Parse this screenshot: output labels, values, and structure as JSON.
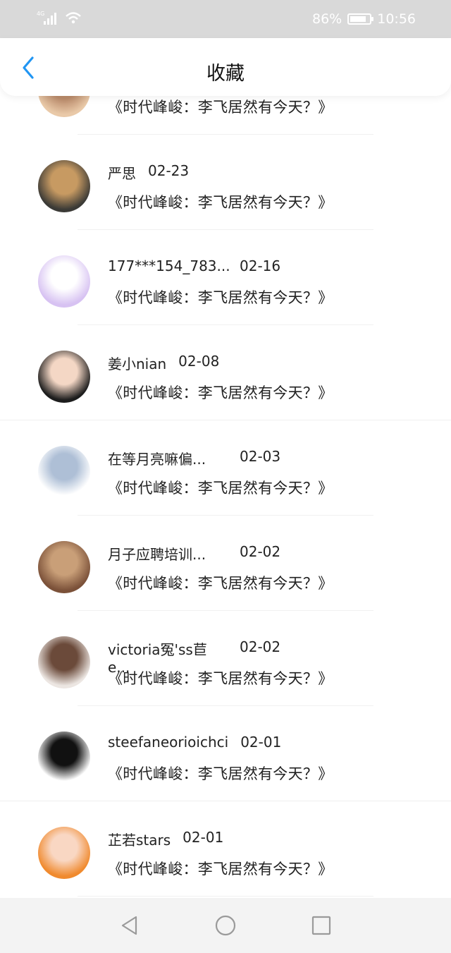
{
  "status_bar": {
    "network": "4G",
    "battery_percent": "86%",
    "battery_level": 0.86,
    "time": "10:56"
  },
  "header": {
    "title": "收藏"
  },
  "items": [
    {
      "name": "",
      "date": "",
      "excerpt": "《时代峰峻：李飞居然有今天？》",
      "avatar_colors": [
        "#e9c9a8",
        "#b98a6a"
      ]
    },
    {
      "name": "严思",
      "date": "02-23",
      "excerpt": "《时代峰峻：李飞居然有今天？》",
      "avatar_colors": [
        "#3b3a36",
        "#c79a62"
      ]
    },
    {
      "name": "177***154_783...",
      "date": "02-16",
      "excerpt": "《时代峰峻：李飞居然有今天？》",
      "avatar_colors": [
        "#d7c2f2",
        "#ffffff"
      ]
    },
    {
      "name": "姜小nian",
      "date": "02-08",
      "excerpt": "《时代峰峻：李飞居然有今天？》",
      "avatar_colors": [
        "#1d1d1d",
        "#f4d7c5"
      ]
    },
    {
      "name": "在等月亮嘛偏...",
      "date": "02-03",
      "excerpt": "《时代峰峻：李飞居然有今天？》",
      "avatar_colors": [
        "#ffffff",
        "#aebfd6"
      ]
    },
    {
      "name": "月子应聘培训...",
      "date": "02-02",
      "excerpt": "《时代峰峻：李飞居然有今天？》",
      "avatar_colors": [
        "#7b5139",
        "#c99f78"
      ]
    },
    {
      "name": "victoria冤'ss苣e...",
      "date": "02-02",
      "excerpt": "《时代峰峻：李飞居然有今天？》",
      "avatar_colors": [
        "#ece6e2",
        "#6b4a3a"
      ]
    },
    {
      "name": "steefaneorioichci",
      "date": "02-01",
      "excerpt": "《时代峰峻：李飞居然有今天？》",
      "avatar_colors": [
        "#ffffff",
        "#111111"
      ]
    },
    {
      "name": "芷若stars",
      "date": "02-01",
      "excerpt": "《时代峰峻：李飞居然有今天？》",
      "avatar_colors": [
        "#f08a2e",
        "#f9d7c3"
      ]
    }
  ]
}
